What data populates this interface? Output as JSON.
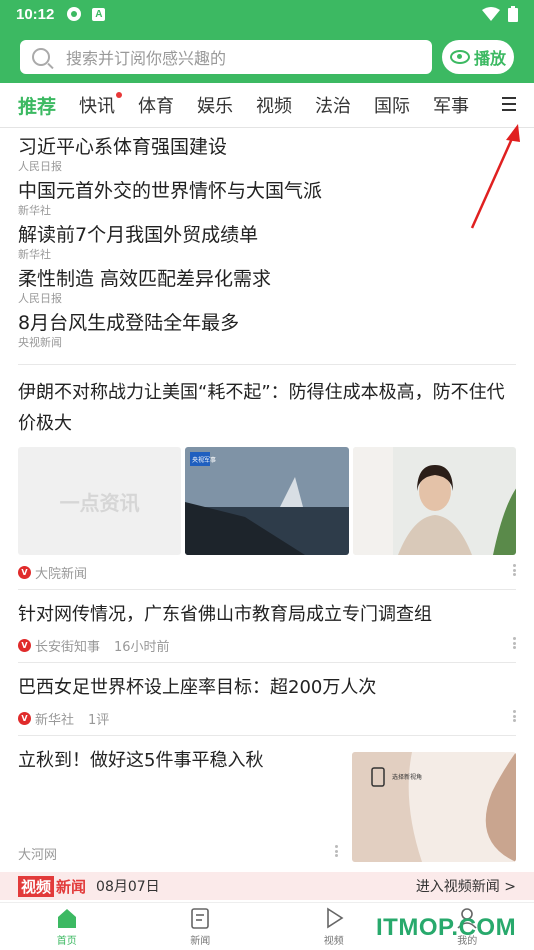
{
  "status_bar": {
    "time": "10:12",
    "icon_a": "A"
  },
  "search": {
    "placeholder": "搜索并订阅你感兴趣的"
  },
  "play_button": {
    "label": "播放"
  },
  "tabs": [
    {
      "label": "推荐"
    },
    {
      "label": "快讯"
    },
    {
      "label": "体育"
    },
    {
      "label": "娱乐"
    },
    {
      "label": "视频"
    },
    {
      "label": "法治"
    },
    {
      "label": "国际"
    },
    {
      "label": "军事"
    }
  ],
  "hot_list": [
    {
      "title": "习近平心系体育强国建设",
      "source": "人民日报"
    },
    {
      "title": "中国元首外交的世界情怀与大国气派",
      "source": "新华社"
    },
    {
      "title": "解读前7个月我国外贸成绩单",
      "source": "新华社"
    },
    {
      "title": "柔性制造 高效匹配差异化需求",
      "source": "人民日报"
    },
    {
      "title": "8月台风生成登陆全年最多",
      "source": "央视新闻"
    }
  ],
  "news": {
    "item1": {
      "title": "伊朗不对称战力让美国“耗不起”：防得住成本极高，防不住代价极大",
      "source": "大院新闻",
      "placeholder_text": "一点资讯",
      "img_badge": "央视军事"
    },
    "item2": {
      "title": "针对网传情况，广东省佛山市教育局成立专门调查组",
      "source": "长安街知事",
      "time": "16小时前"
    },
    "item3": {
      "title": "巴西女足世界杯设上座率目标：超200万人次",
      "source": "新华社",
      "comments": "1评"
    },
    "item4": {
      "title": "立秋到！做好这5件事平稳入秋",
      "source": "大河网",
      "img_caption": "选择新视角"
    }
  },
  "video_banner": {
    "tag1": "视频",
    "tag2": "新闻",
    "date": "08月07日",
    "enter": "进入视频新闻 >"
  },
  "bottom_nav": [
    {
      "label": "首页"
    },
    {
      "label": "新闻"
    },
    {
      "label": "视频"
    },
    {
      "label": "我的"
    }
  ],
  "watermark": "ITMOP.COM",
  "colors": {
    "accent": "#3cb962",
    "red": "#e83838"
  }
}
